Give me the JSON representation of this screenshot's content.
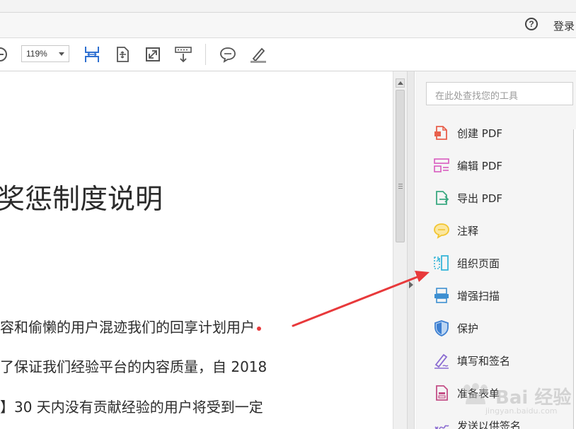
{
  "header": {
    "help_icon": "question-circle-icon",
    "help_glyph": "?",
    "login_label": "登录"
  },
  "toolbar": {
    "zoom_value": "119%",
    "icons": [
      "zoom-out-icon",
      "fit-width-icon",
      "fit-page-icon",
      "full-screen-icon",
      "scroll-mode-icon",
      "comment-icon",
      "highlight-pen-icon"
    ]
  },
  "document": {
    "title": "奖惩制度说明",
    "lines": [
      "容和偷懒的用户混迹我们的回享计划用户",
      "了保证我们经验平台的内容质量，自 2018",
      "】30 天内没有贡献经验的用户将受到一定"
    ]
  },
  "tools_panel": {
    "search_placeholder": "在此处查找您的工具",
    "items": [
      {
        "label": "创建 PDF",
        "icon": "create-pdf-icon"
      },
      {
        "label": "编辑 PDF",
        "icon": "edit-pdf-icon"
      },
      {
        "label": "导出 PDF",
        "icon": "export-pdf-icon"
      },
      {
        "label": "注释",
        "icon": "comment-bubble-icon"
      },
      {
        "label": "组织页面",
        "icon": "organize-pages-icon"
      },
      {
        "label": "增强扫描",
        "icon": "enhance-scan-icon"
      },
      {
        "label": "保护",
        "icon": "shield-icon"
      },
      {
        "label": "填写和签名",
        "icon": "fill-sign-icon"
      },
      {
        "label": "准备表单",
        "icon": "prepare-form-icon"
      },
      {
        "label": "发送以供签名",
        "icon": "send-signature-icon"
      }
    ]
  },
  "watermark": {
    "text": "Bai 经验",
    "url": "jingyan.baidu.com"
  },
  "colors": {
    "annotation_arrow": "#e8393b",
    "create_pdf": "#e8604c",
    "edit_pdf": "#d95bbf",
    "export_pdf": "#3aa981",
    "comment": "#f2c531",
    "organize": "#38b6d9",
    "scan": "#3d8fd1",
    "protect": "#3d7fd1",
    "fill_sign": "#8a6bd1"
  }
}
